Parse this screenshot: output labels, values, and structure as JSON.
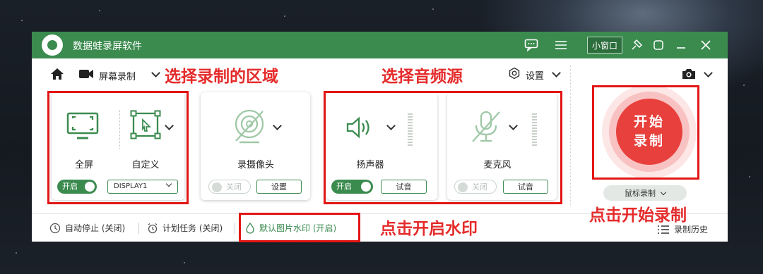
{
  "app": {
    "title": "数据蛙录屏软件",
    "mini_window": "小窗口"
  },
  "nav": {
    "mode": "屏幕录制",
    "settings": "设置"
  },
  "screen": {
    "fullscreen": "全屏",
    "custom": "自定义",
    "toggle": "开启",
    "display": "DISPLAY1"
  },
  "camera": {
    "label": "录摄像头",
    "toggle": "关闭",
    "button": "设置"
  },
  "speaker": {
    "label": "扬声器",
    "toggle": "开启",
    "button": "试音"
  },
  "mic": {
    "label": "麦克风",
    "toggle": "关闭",
    "button": "试音"
  },
  "record": {
    "line1": "开始",
    "line2": "录制",
    "mouse": "鼠标录制"
  },
  "bottom": {
    "auto_stop": "自动停止 (关闭)",
    "schedule": "计划任务 (关闭)",
    "watermark": "默认图片水印 (开启)",
    "history": "录制历史"
  },
  "annotations": {
    "select_area": "选择录制的区域",
    "select_audio": "选择音频源",
    "start_record": "点击开始录制",
    "enable_watermark": "点击开启水印"
  },
  "colors": {
    "accent": "#3b8b4f",
    "record": "#e8403c",
    "annotation": "#e52b2b"
  }
}
